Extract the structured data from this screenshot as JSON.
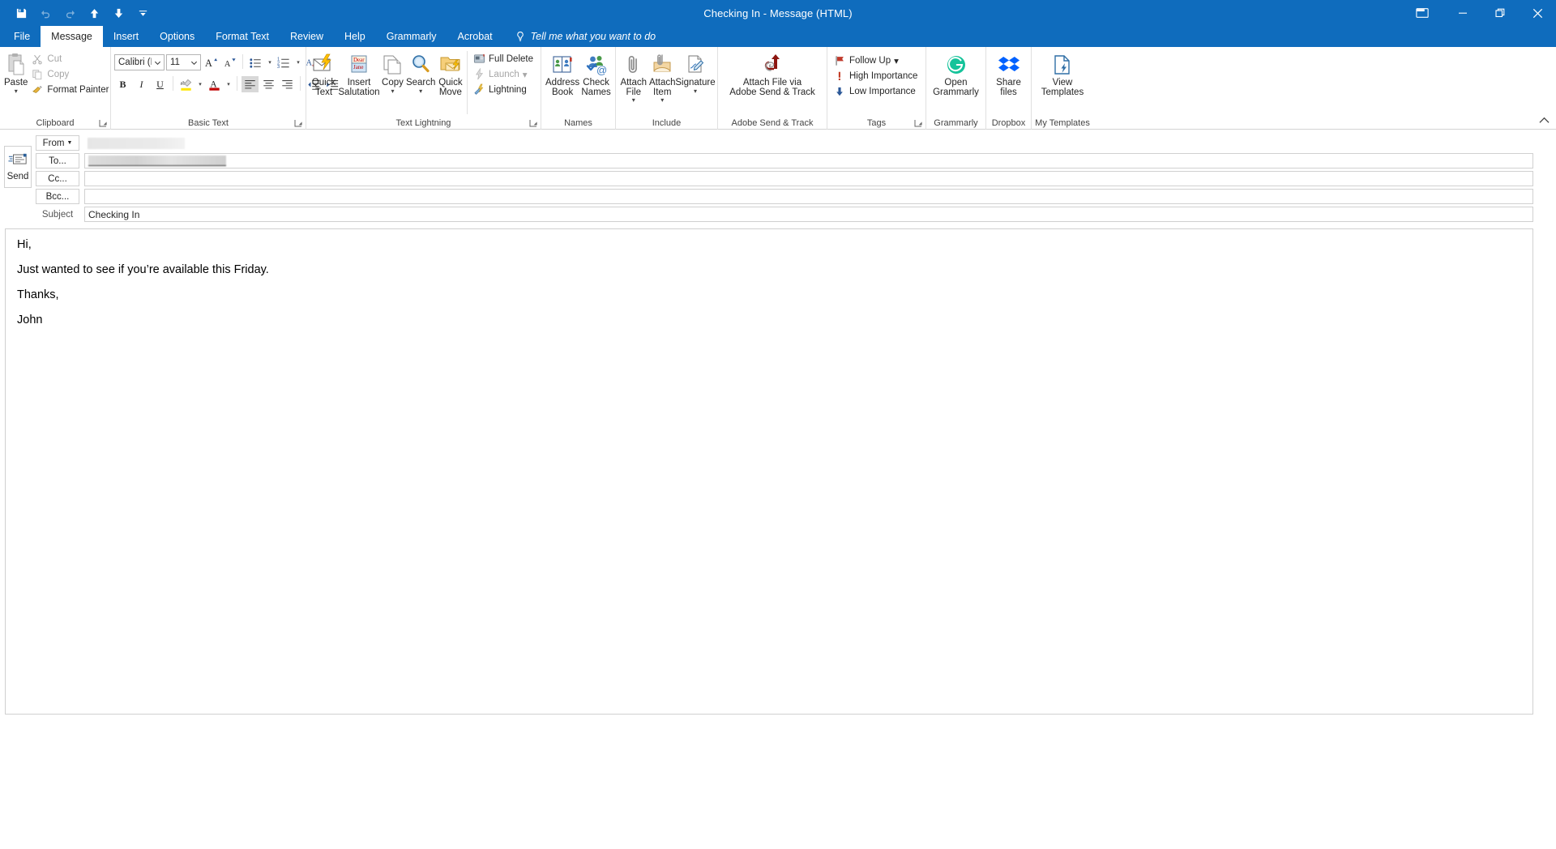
{
  "window": {
    "title": "Checking In  -  Message (HTML)",
    "quick_access": [
      {
        "name": "save-icon",
        "label": "Save",
        "disabled": false
      },
      {
        "name": "undo-icon",
        "label": "Undo",
        "disabled": true
      },
      {
        "name": "redo-icon",
        "label": "Redo",
        "disabled": true
      },
      {
        "name": "previous-item-icon",
        "label": "Previous Item",
        "disabled": false
      },
      {
        "name": "next-item-icon",
        "label": "Next Item",
        "disabled": false
      },
      {
        "name": "customize-quick-access-toolbar-icon",
        "label": "Customize Quick Access Toolbar",
        "disabled": false
      }
    ],
    "controls": [
      {
        "name": "ribbon-display-options-button",
        "label": "Ribbon Display Options"
      },
      {
        "name": "minimize-button",
        "label": "Minimize"
      },
      {
        "name": "restore-button",
        "label": "Restore Down"
      },
      {
        "name": "close-button",
        "label": "Close"
      }
    ]
  },
  "tabs": [
    {
      "label": "File",
      "active": false
    },
    {
      "label": "Message",
      "active": true
    },
    {
      "label": "Insert",
      "active": false
    },
    {
      "label": "Options",
      "active": false
    },
    {
      "label": "Format Text",
      "active": false
    },
    {
      "label": "Review",
      "active": false
    },
    {
      "label": "Help",
      "active": false
    },
    {
      "label": "Grammarly",
      "active": false
    },
    {
      "label": "Acrobat",
      "active": false
    }
  ],
  "tell_me": "Tell me what you want to do",
  "ribbon": {
    "groups": [
      {
        "label": "Clipboard",
        "has_launcher": true,
        "paste": {
          "label": "Paste"
        },
        "items": [
          {
            "label": "Cut",
            "icon": "scissors-icon",
            "disabled": true
          },
          {
            "label": "Copy",
            "icon": "copy-icon",
            "disabled": true
          },
          {
            "label": "Format Painter",
            "icon": "format-painter-icon",
            "disabled": false
          }
        ]
      },
      {
        "label": "Basic Text",
        "has_launcher": true,
        "font_name": "Calibri (B",
        "font_size": "11",
        "buttons_row1": [
          "grow-font-icon",
          "shrink-font-icon",
          "bullets-icon",
          "numbering-icon",
          "multilevel-list-icon",
          "clear-formatting-icon"
        ],
        "buttons_row2": [
          "bold-icon",
          "italic-icon",
          "underline-icon",
          "text-highlight-color-icon",
          "font-color-icon",
          "align-left-icon",
          "align-center-icon",
          "align-right-icon",
          "decrease-indent-icon",
          "increase-indent-icon"
        ]
      },
      {
        "label": "Text Lightning",
        "has_launcher": true,
        "big_items": [
          {
            "label": "Quick\nText",
            "icon": "quick-text-icon",
            "caret": false
          },
          {
            "label": "Insert\nSalutation",
            "icon": "insert-salutation-icon",
            "caret": false
          },
          {
            "label": "Copy",
            "icon": "copy-pages-icon",
            "caret": true
          },
          {
            "label": "Search",
            "icon": "search-magnifier-icon",
            "caret": true
          },
          {
            "label": "Quick\nMove",
            "icon": "quick-move-icon",
            "caret": false
          }
        ],
        "small_items": [
          {
            "label": "Full Delete",
            "icon": "full-delete-icon",
            "disabled": false,
            "caret": false
          },
          {
            "label": "Launch",
            "icon": "launch-icon",
            "disabled": true,
            "caret": true
          },
          {
            "label": "Lightning",
            "icon": "lightning-tools-icon",
            "disabled": false,
            "caret": false
          }
        ]
      },
      {
        "label": "Names",
        "has_launcher": false,
        "big_items": [
          {
            "label": "Address\nBook",
            "icon": "address-book-icon",
            "caret": false
          },
          {
            "label": "Check\nNames",
            "icon": "check-names-icon",
            "caret": false
          }
        ]
      },
      {
        "label": "Include",
        "has_launcher": false,
        "big_items": [
          {
            "label": "Attach\nFile",
            "icon": "paperclip-icon",
            "caret": true
          },
          {
            "label": "Attach\nItem",
            "icon": "attach-item-icon",
            "caret": true
          },
          {
            "label": "Signature",
            "icon": "signature-icon",
            "caret": true
          }
        ]
      },
      {
        "label": "Adobe Send & Track",
        "has_launcher": false,
        "big_items": [
          {
            "label": "Attach File via\nAdobe Send & Track",
            "icon": "adobe-send-track-icon",
            "caret": false
          }
        ]
      },
      {
        "label": "Tags",
        "has_launcher": true,
        "small_items": [
          {
            "label": "Follow Up",
            "icon": "flag-icon",
            "disabled": false,
            "caret": true
          },
          {
            "label": "High Importance",
            "icon": "high-importance-icon",
            "disabled": false,
            "caret": false
          },
          {
            "label": "Low Importance",
            "icon": "low-importance-icon",
            "disabled": false,
            "caret": false
          }
        ]
      },
      {
        "label": "Grammarly",
        "has_launcher": false,
        "big_items": [
          {
            "label": "Open\nGrammarly",
            "icon": "grammarly-icon",
            "caret": false
          }
        ]
      },
      {
        "label": "Dropbox",
        "has_launcher": false,
        "big_items": [
          {
            "label": "Share\nfiles",
            "icon": "dropbox-icon",
            "caret": false
          }
        ]
      },
      {
        "label": "My Templates",
        "has_launcher": false,
        "big_items": [
          {
            "label": "View\nTemplates",
            "icon": "view-templates-icon",
            "caret": false
          }
        ]
      }
    ],
    "collapse_label": "Collapse the Ribbon"
  },
  "compose": {
    "send_label": "Send",
    "from": {
      "label": "From",
      "value": "",
      "redacted": true
    },
    "to": {
      "label": "To...",
      "value": "",
      "redacted": true
    },
    "cc": {
      "label": "Cc...",
      "value": ""
    },
    "bcc": {
      "label": "Bcc...",
      "value": ""
    },
    "subject": {
      "label": "Subject",
      "value": "Checking In"
    },
    "body": [
      "Hi,",
      "",
      "Just wanted to see if you’re available this Friday.",
      "",
      "Thanks,",
      "",
      "John"
    ]
  },
  "colors": {
    "accent": "#0f6cbd",
    "ribbon_bg": "#ffffff",
    "border": "#d0d0d0",
    "grammarly_green": "#15c39a",
    "dropbox_blue": "#0061ff",
    "adobe_red": "#8c1610",
    "high_importance_red": "#c0341d",
    "low_importance_blue": "#2b5797"
  }
}
